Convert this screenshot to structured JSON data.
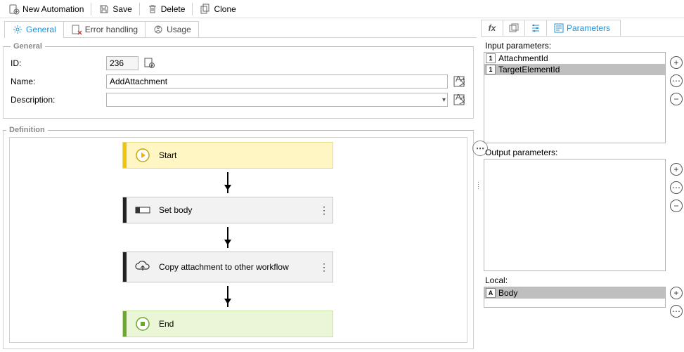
{
  "toolbar": {
    "newAutomation": "New Automation",
    "save": "Save",
    "delete": "Delete",
    "clone": "Clone"
  },
  "tabs": {
    "general": "General",
    "errorHandling": "Error handling",
    "usage": "Usage"
  },
  "general": {
    "legend": "General",
    "idLabel": "ID:",
    "idValue": "236",
    "nameLabel": "Name:",
    "nameValue": "AddAttachment",
    "descLabel": "Description:"
  },
  "definition": {
    "legend": "Definition",
    "start": "Start",
    "setBody": "Set body",
    "copy": "Copy attachment to other workflow",
    "end": "End"
  },
  "rightTabs": {
    "parameters": "Parameters"
  },
  "params": {
    "inputTitle": "Input parameters:",
    "inputs": [
      {
        "badge": "1",
        "name": "AttachmentId"
      },
      {
        "badge": "1",
        "name": "TargetElementId"
      }
    ],
    "outputTitle": "Output parameters:",
    "localTitle": "Local:",
    "locals": [
      {
        "badge": "A",
        "name": "Body"
      }
    ]
  },
  "ellipsis": "⋯"
}
